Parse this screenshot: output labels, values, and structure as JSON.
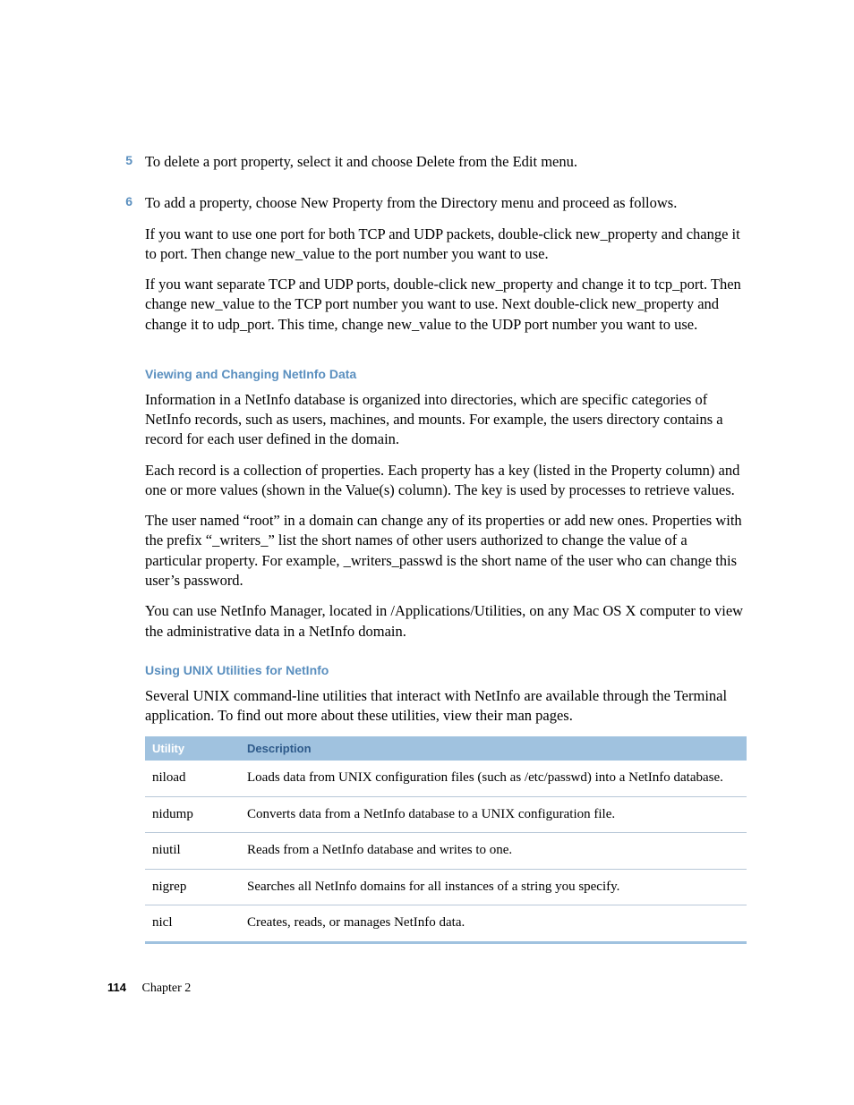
{
  "steps": [
    {
      "num": "5",
      "paras": [
        "To delete a port property, select it and choose Delete from the Edit menu."
      ]
    },
    {
      "num": "6",
      "paras": [
        "To add a property, choose New Property from the Directory menu and proceed as follows.",
        "If you want to use one port for both TCP and UDP packets, double-click new_property and change it to port. Then change new_value to the port number you want to use.",
        "If you want separate TCP and UDP ports, double-click new_property and change it to tcp_port. Then change new_value to the TCP port number you want to use. Next double-click new_property and change it to udp_port. This time, change new_value to the UDP port number you want to use."
      ]
    }
  ],
  "section1": {
    "heading": "Viewing and Changing NetInfo Data",
    "paras": [
      "Information in a NetInfo database is organized into directories, which are specific categories of NetInfo records, such as users, machines, and mounts. For example, the users directory contains a record for each user defined in the domain.",
      "Each record is a collection of properties. Each property has a key (listed in the Property column) and one or more values (shown in the Value(s) column). The key is used by processes to retrieve values.",
      "The user named “root” in a domain can change any of its properties or add new ones. Properties with the prefix “_writers_” list the short names of other users authorized to change the value of a particular property. For example, _writers_passwd is the short name of the user who can change this user’s password.",
      "You can use NetInfo Manager, located in /Applications/Utilities, on any Mac OS X computer to view the administrative data in a NetInfo domain."
    ]
  },
  "section2": {
    "heading": "Using UNIX Utilities for NetInfo",
    "paras": [
      "Several UNIX command-line utilities that interact with NetInfo are available through the Terminal application. To find out more about these utilities, view their man pages."
    ]
  },
  "table": {
    "headers": [
      "Utility",
      "Description"
    ],
    "rows": [
      {
        "u": "niload",
        "d": "Loads data from UNIX configuration files (such as /etc/passwd) into a NetInfo database."
      },
      {
        "u": "nidump",
        "d": "Converts data from a NetInfo database to a UNIX configuration file."
      },
      {
        "u": "niutil",
        "d": "Reads from a NetInfo database and writes to one."
      },
      {
        "u": "nigrep",
        "d": "Searches all NetInfo domains for all instances of a string you specify."
      },
      {
        "u": "nicl",
        "d": "Creates, reads, or manages NetInfo data."
      }
    ]
  },
  "footer": {
    "page": "114",
    "chapter": "Chapter  2"
  }
}
